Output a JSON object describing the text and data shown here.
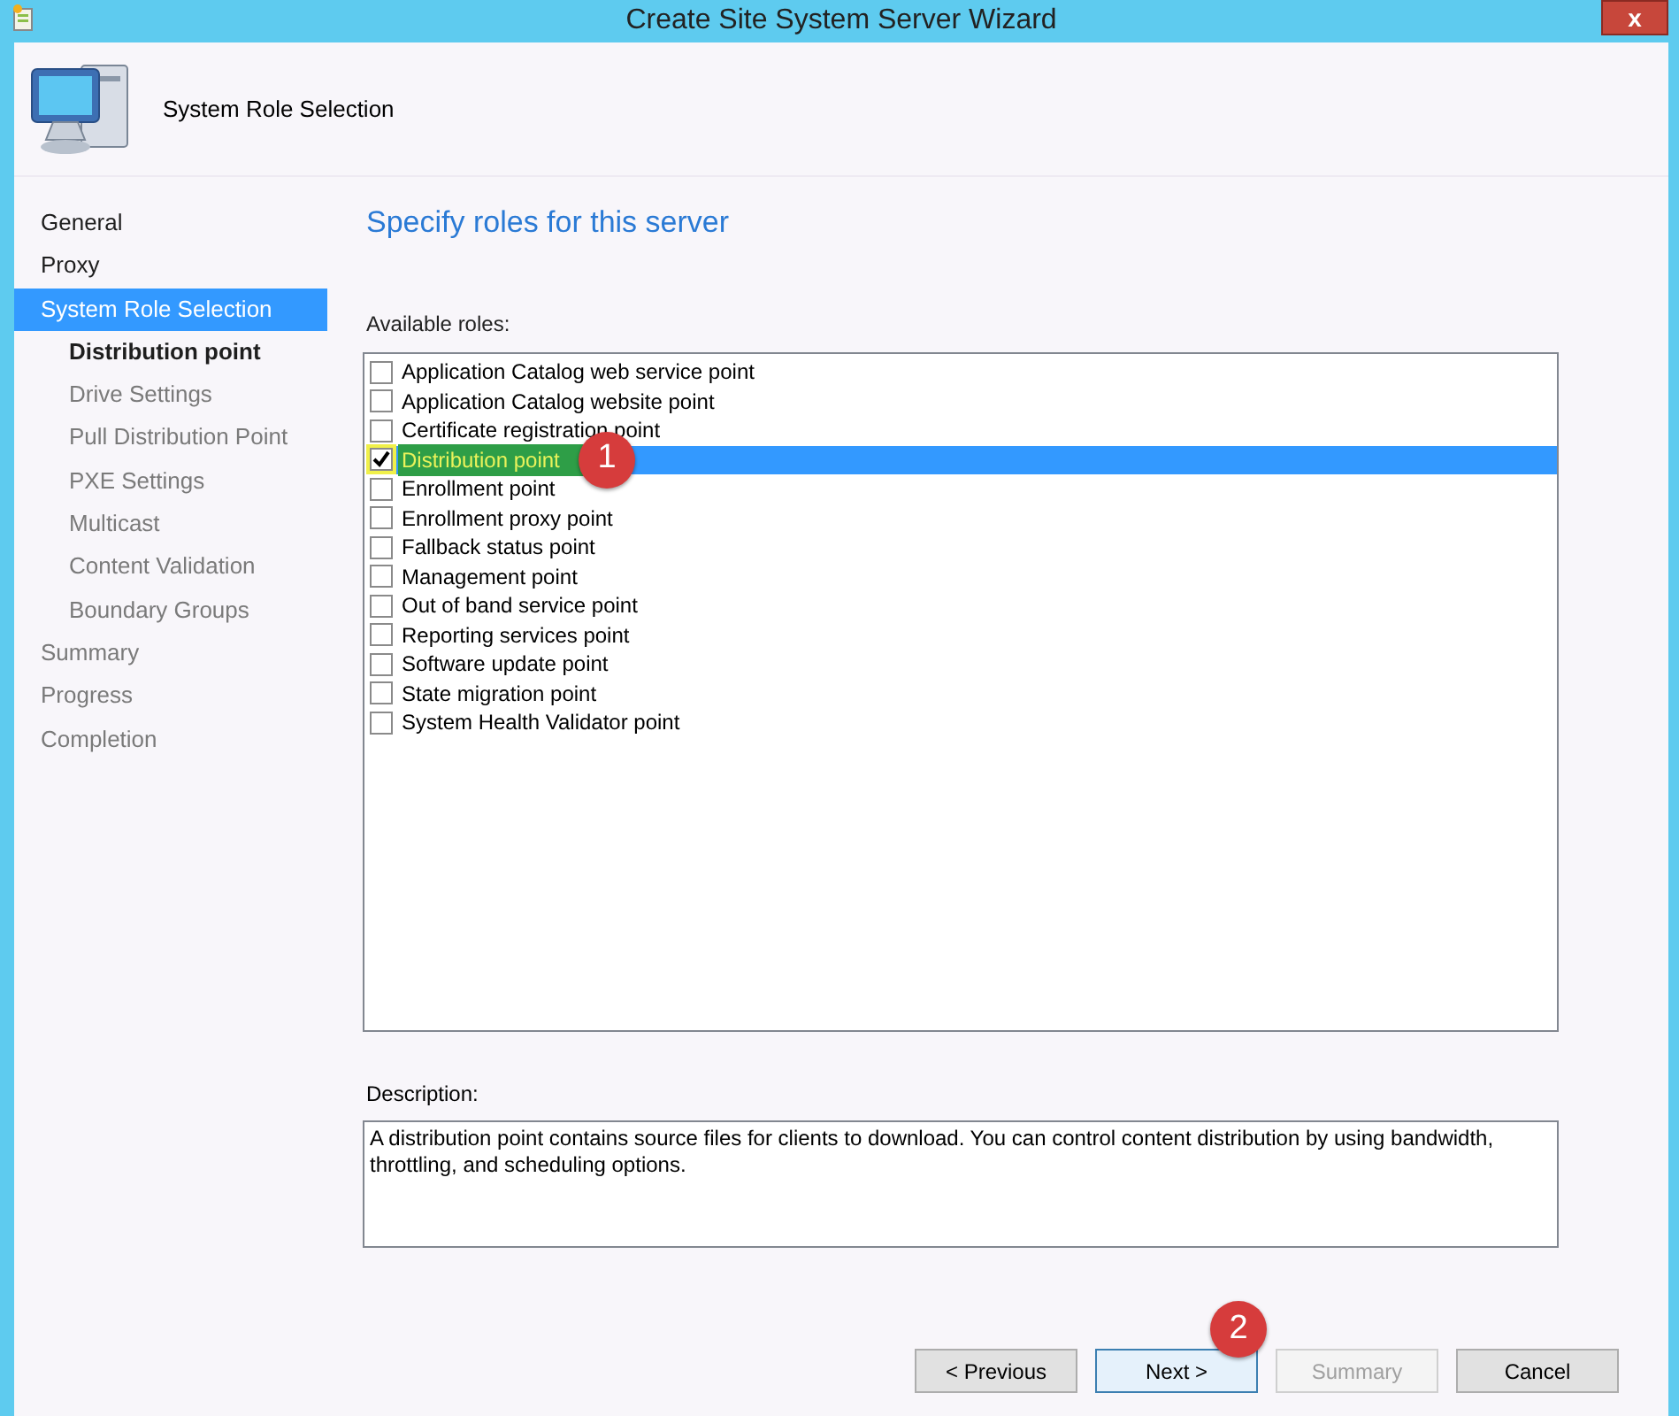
{
  "window": {
    "title": "Create Site System Server Wizard",
    "close": "x"
  },
  "header": {
    "title": "System Role Selection"
  },
  "nav": [
    {
      "label": "General",
      "selected": false,
      "completed": true,
      "current": false
    },
    {
      "label": "Proxy",
      "selected": false,
      "completed": true,
      "current": false
    },
    {
      "label": "System Role Selection",
      "selected": true,
      "completed": true,
      "current": false,
      "children": [
        {
          "label": "Distribution point",
          "selected": false,
          "completed": true,
          "current": true
        },
        {
          "label": "Drive Settings",
          "selected": false,
          "completed": false,
          "current": false
        },
        {
          "label": "Pull Distribution Point",
          "selected": false,
          "completed": false,
          "current": false
        },
        {
          "label": "PXE Settings",
          "selected": false,
          "completed": false,
          "current": false
        },
        {
          "label": "Multicast",
          "selected": false,
          "completed": false,
          "current": false
        },
        {
          "label": "Content Validation",
          "selected": false,
          "completed": false,
          "current": false
        },
        {
          "label": "Boundary Groups",
          "selected": false,
          "completed": false,
          "current": false
        }
      ]
    },
    {
      "label": "Summary",
      "selected": false,
      "completed": false,
      "current": false
    },
    {
      "label": "Progress",
      "selected": false,
      "completed": false,
      "current": false
    },
    {
      "label": "Completion",
      "selected": false,
      "completed": false,
      "current": false
    }
  ],
  "page_heading": "Specify roles for this server",
  "roles_label": "Available roles:",
  "roles": [
    {
      "label": "Application Catalog web service point",
      "checked": false,
      "selected": false
    },
    {
      "label": "Application Catalog website point",
      "checked": false,
      "selected": false
    },
    {
      "label": "Certificate registration point",
      "checked": false,
      "selected": false
    },
    {
      "label": "Distribution point",
      "checked": true,
      "selected": true,
      "highlighted": true,
      "badge": "1"
    },
    {
      "label": "Enrollment point",
      "checked": false,
      "selected": false
    },
    {
      "label": "Enrollment proxy point",
      "checked": false,
      "selected": false
    },
    {
      "label": "Fallback status point",
      "checked": false,
      "selected": false
    },
    {
      "label": "Management point",
      "checked": false,
      "selected": false
    },
    {
      "label": "Out of band service point",
      "checked": false,
      "selected": false
    },
    {
      "label": "Reporting services point",
      "checked": false,
      "selected": false
    },
    {
      "label": "Software update point",
      "checked": false,
      "selected": false
    },
    {
      "label": "State migration point",
      "checked": false,
      "selected": false
    },
    {
      "label": "System Health Validator point",
      "checked": false,
      "selected": false
    }
  ],
  "description_label": "Description:",
  "description": "A distribution point contains source files for clients to download. You can control content distribution by using bandwidth, throttling, and scheduling options.",
  "buttons": [
    {
      "label": "< Previous",
      "disabled": false,
      "focused": false
    },
    {
      "label": "Next >",
      "disabled": false,
      "focused": true,
      "badge": "2"
    },
    {
      "label": "Summary",
      "disabled": true,
      "focused": false
    },
    {
      "label": "Cancel",
      "disabled": false,
      "focused": false
    }
  ]
}
